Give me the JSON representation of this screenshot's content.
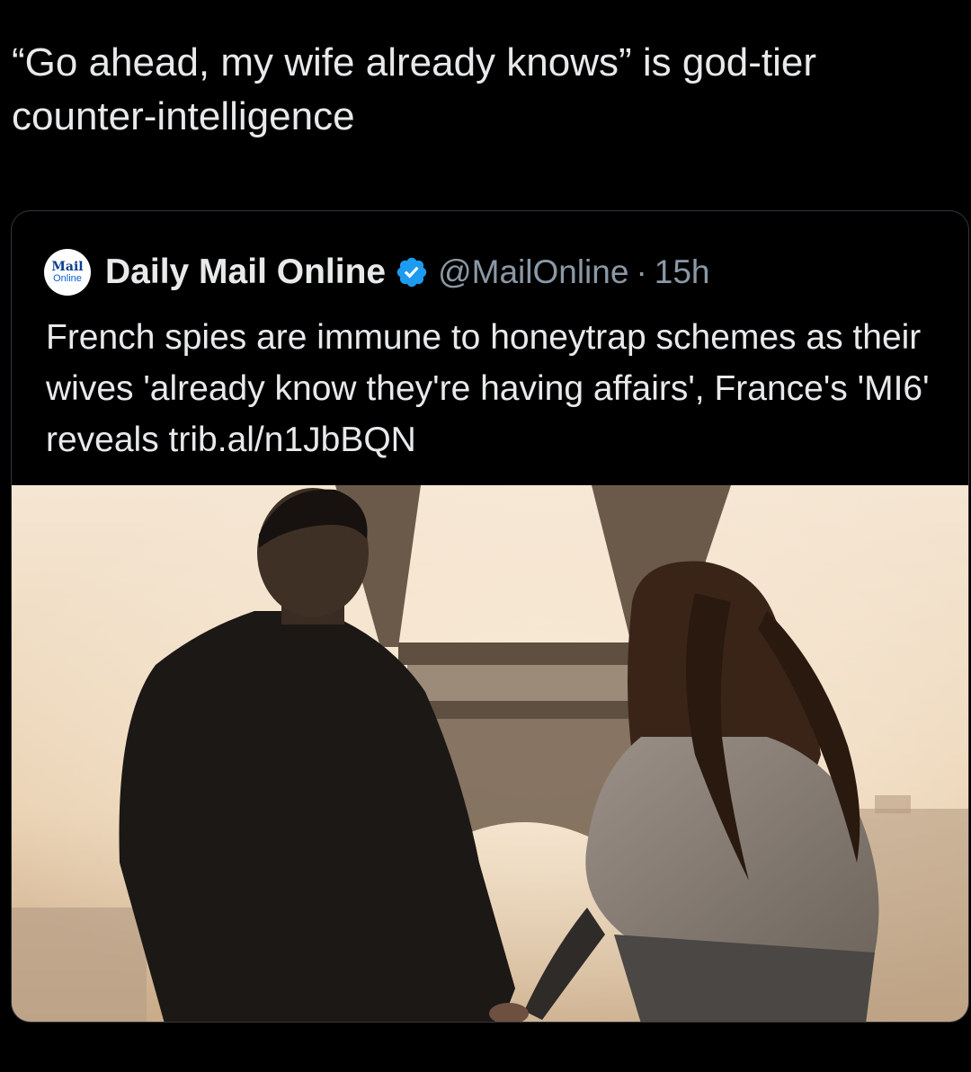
{
  "post": {
    "text": "“Go ahead, my wife already knows” is god-tier counter-intelligence"
  },
  "quoted_post": {
    "avatar": {
      "line1": "Mail",
      "line2": "Online"
    },
    "display_name": "Daily Mail Online",
    "verified_icon": "verified-badge-icon",
    "handle": "@MailOnline",
    "separator": "·",
    "time": "15h",
    "text": "French spies are immune to honeytrap schemes as their wives 'already know they're having affairs', France's 'MI6' reveals trib.al/n1JbBQN",
    "media": {
      "type": "photo",
      "subject": "couple-eiffel-tower-photo"
    }
  },
  "colors": {
    "background": "#000000",
    "text_primary": "#e7e9ea",
    "text_secondary": "#8b98a5",
    "card_border": "#333639",
    "verified_blue": "#1d9bf0"
  }
}
